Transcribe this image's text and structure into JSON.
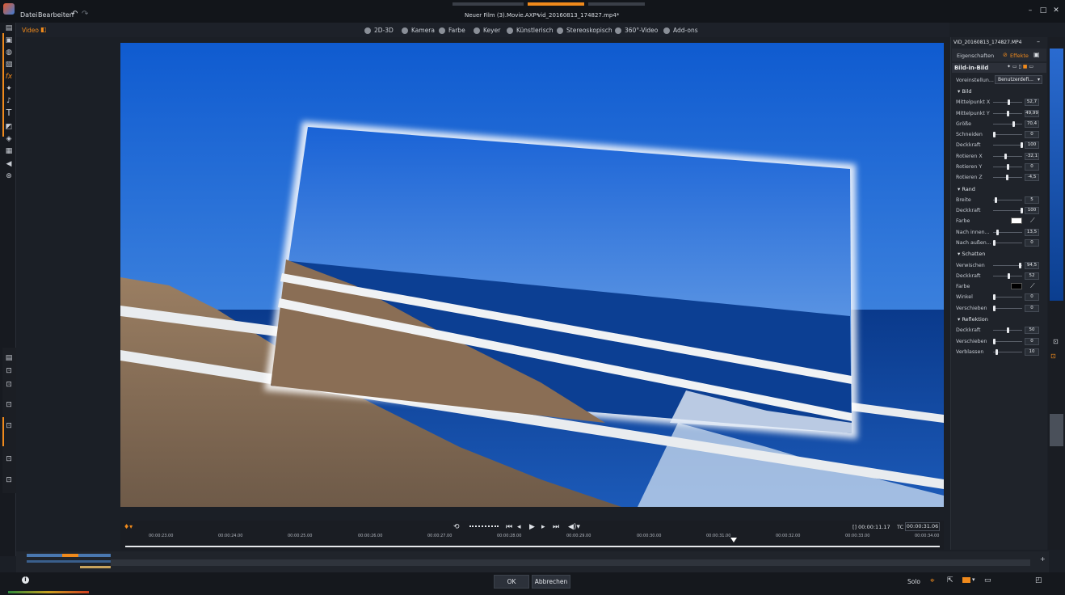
{
  "app": {
    "menu": [
      "Datei",
      "Bearbeiten"
    ],
    "tabs": [
      "Neuer Film (3).Movie.AXP*",
      "vid_20160813_174827.mp4*"
    ]
  },
  "videobar": {
    "label": "Video",
    "tabs": [
      "2D-3D",
      "Kamera",
      "Farbe",
      "Keyer",
      "Künstlerisch",
      "Stereoskopisch",
      "360°-Video",
      "Add-ons"
    ]
  },
  "transport": {
    "ticks": [
      "00:00:23.00",
      "00:00:24.00",
      "00:00:25.00",
      "00:00:26.00",
      "00:00:27.00",
      "00:00:28.00",
      "00:00:29.00",
      "00:00:30.00",
      "00:00:31.00",
      "00:00:32.00",
      "00:00:33.00",
      "00:00:34.00"
    ],
    "timecode": "[] 00:00:11.17",
    "tc_label": "TC",
    "tc_value": "00:00:31.06"
  },
  "bottom": {
    "ok": "OK",
    "cancel": "Abbrechen",
    "solo": "Solo"
  },
  "panel": {
    "filename": "VID_20160813_174827.MP4",
    "tab_properties": "Eigenschaften",
    "tab_effects": "Effekte",
    "effect_title": "Bild-in-Bild",
    "preset_label": "Voreinstellun...",
    "preset_value": "Benutzerdefi...",
    "sections": [
      {
        "title": "Bild",
        "rows": [
          {
            "label": "Mittelpunkt X",
            "value": "52,7",
            "level": 0.52
          },
          {
            "label": "Mittelpunkt Y",
            "value": "49,99",
            "level": 0.5
          },
          {
            "label": "Größe",
            "value": "70,4",
            "level": 0.7
          },
          {
            "label": "Schneiden",
            "value": "0",
            "level": 0.0
          },
          {
            "label": "Deckkraft",
            "value": "100",
            "level": 1.0
          },
          {
            "label": "Rotieren X",
            "value": "-32,1",
            "level": 0.41
          },
          {
            "label": "Rotieren Y",
            "value": "0",
            "level": 0.5
          },
          {
            "label": "Rotieren Z",
            "value": "-4,5",
            "level": 0.48
          }
        ]
      },
      {
        "title": "Rand",
        "rows": [
          {
            "label": "Breite",
            "value": "5",
            "level": 0.05
          },
          {
            "label": "Deckkraft",
            "value": "100",
            "level": 1.0
          },
          {
            "label": "Farbe",
            "swatch": "#ffffff"
          },
          {
            "label": "Nach innen...",
            "value": "13,5",
            "level": 0.13
          },
          {
            "label": "Nach außen...",
            "value": "0",
            "level": 0.0
          }
        ]
      },
      {
        "title": "Schatten",
        "rows": [
          {
            "label": "Verwischen",
            "value": "94,5",
            "level": 0.94
          },
          {
            "label": "Deckkraft",
            "value": "52",
            "level": 0.52
          },
          {
            "label": "Farbe",
            "swatch": "#000000"
          },
          {
            "label": "Winkel",
            "value": "0",
            "level": 0.0
          },
          {
            "label": "Verschieben",
            "value": "0",
            "level": 0.0
          }
        ]
      },
      {
        "title": "Reflektion",
        "rows": [
          {
            "label": "Deckkraft",
            "value": "50",
            "level": 0.5
          },
          {
            "label": "Verschieben",
            "value": "0",
            "level": 0.0
          },
          {
            "label": "Verblassen",
            "value": "10",
            "level": 0.1
          }
        ]
      }
    ]
  },
  "colors": {
    "accent": "#f08a1c",
    "sky": "#1f6fd8",
    "sea": "#0b3e8f"
  }
}
